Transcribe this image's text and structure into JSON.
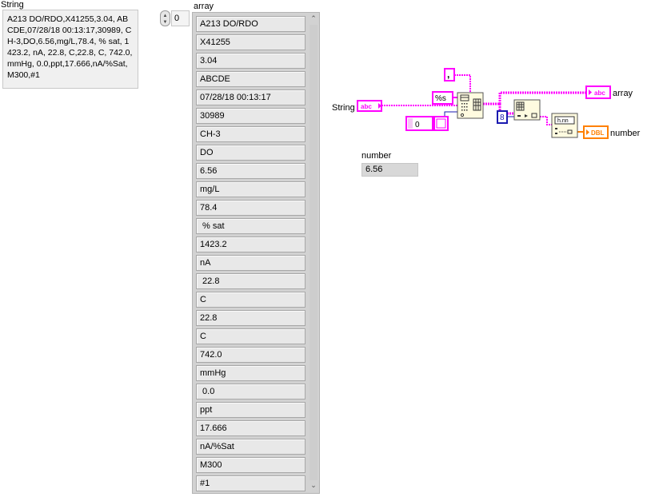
{
  "string_panel": {
    "label": "String",
    "value": "A213 DO/RDO,X41255,3.04, ABCDE,07/28/18 00:13:17,30989, CH-3,DO,6.56,mg/L,78.4, % sat, 1423.2, nA, 22.8, C,22.8, C, 742.0,mmHg, 0.0,ppt,17.666,nA/%Sat,M300,#1"
  },
  "index_control": {
    "value": "0"
  },
  "array_panel": {
    "label": "array",
    "elements": [
      "A213 DO/RDO",
      "X41255",
      "3.04",
      "ABCDE",
      "07/28/18 00:13:17",
      "30989",
      "CH-3",
      "DO",
      "6.56",
      "mg/L",
      "78.4",
      " % sat",
      "1423.2",
      "nA",
      " 22.8",
      "C",
      "22.8",
      "C",
      "742.0",
      "mmHg",
      " 0.0",
      "ppt",
      "17.666",
      "nA/%Sat",
      "M300",
      "#1"
    ]
  },
  "number_panel": {
    "label": "number",
    "value": "6.56"
  },
  "diagram": {
    "string_terminal_label": "String",
    "string_terminal_glyph": "abc",
    "delimiter_const": ",",
    "format_const": "%s",
    "offset_const": "0",
    "index_const": "8",
    "array_indicator_glyph": "abc",
    "array_indicator_label": "array",
    "number_indicator_glyph": "DBL",
    "number_indicator_label": "number",
    "convert_glyph": "h.nn",
    "string_wire_color": "#ff00ff",
    "numeric_wire_color": "#1a1ab0",
    "dbl_color": "#ff8000"
  },
  "icons": {
    "spin_up": "▲",
    "spin_down": "▼",
    "scroll_up": "⌃",
    "scroll_down": "⌄"
  }
}
